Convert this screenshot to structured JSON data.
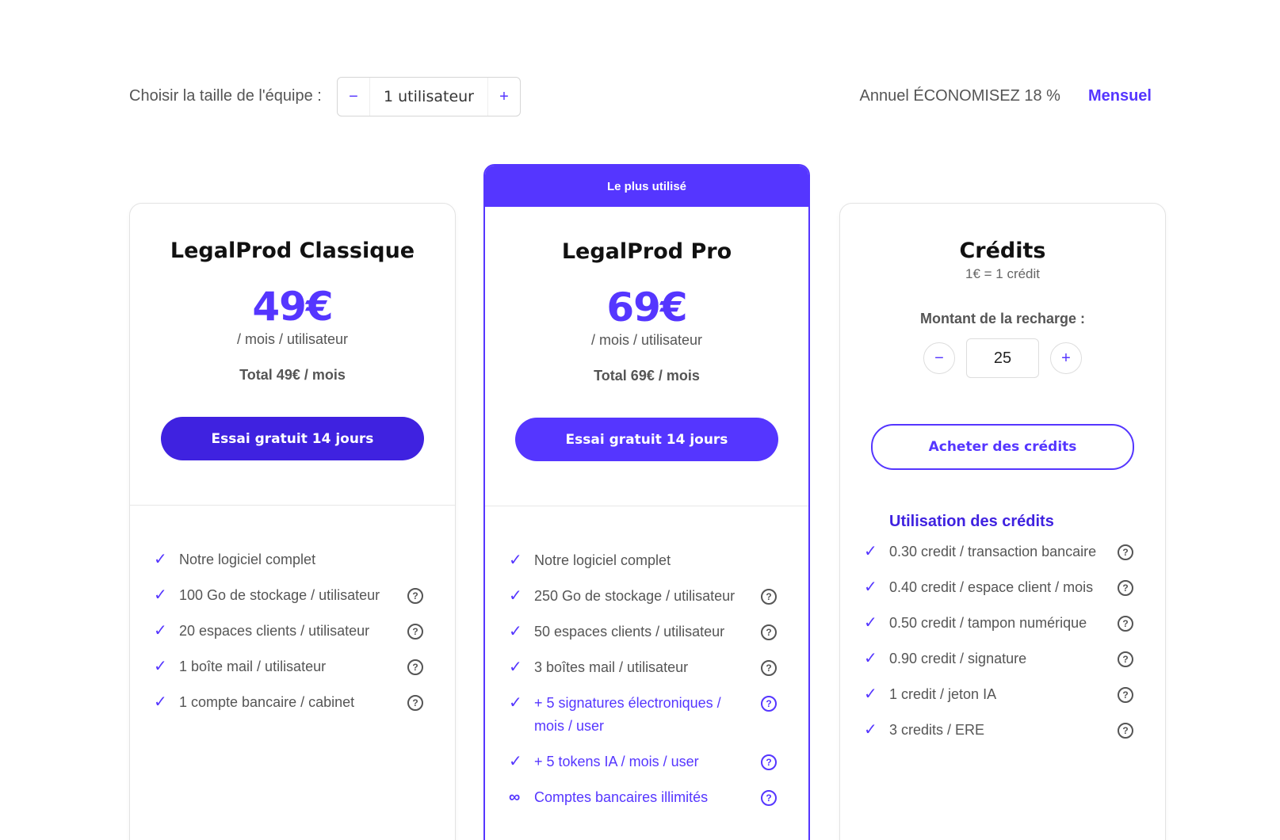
{
  "team": {
    "label": "Choisir la taille de l'équipe :",
    "minus": "−",
    "value": "1 utilisateur",
    "plus": "+"
  },
  "billing": {
    "annual": "Annuel ÉCONOMISEZ 18 %",
    "monthly": "Mensuel"
  },
  "icons": {
    "check": "✓",
    "help": "?",
    "infinity": "∞"
  },
  "colors": {
    "accent": "#5536ff",
    "accent_dark": "#3f22e0"
  },
  "plans": [
    {
      "name": "LegalProd Classique",
      "price": "49€",
      "per": "/ mois / utilisateur",
      "total": "Total 49€ / mois",
      "cta": "Essai gratuit 14 jours",
      "features": [
        "Notre logiciel complet",
        "100 Go de stockage / utilisateur",
        "20 espaces clients / utilisateur",
        "1 boîte mail / utilisateur",
        "1 compte bancaire / cabinet"
      ]
    },
    {
      "badge": "Le plus utilisé",
      "name": "LegalProd Pro",
      "price": "69€",
      "per": "/ mois / utilisateur",
      "total": "Total 69€ / mois",
      "cta": "Essai gratuit 14 jours",
      "features": [
        "Notre logiciel complet",
        "250 Go de stockage / utilisateur",
        "50 espaces clients / utilisateur",
        "3 boîtes mail / utilisateur",
        "+ 5 signatures électroniques / mois / user",
        "+ 5 tokens IA / mois / user",
        "Comptes bancaires illimités"
      ]
    }
  ],
  "credits": {
    "name": "Crédits",
    "rate": "1€ = 1 crédit",
    "recharge_label": "Montant de la recharge :",
    "minus": "−",
    "amount": "25",
    "plus": "+",
    "cta": "Acheter des crédits",
    "usage_title": "Utilisation des crédits",
    "usage": [
      "0.30 credit / transaction bancaire",
      "0.40 credit / espace client / mois",
      "0.50 credit / tampon numérique",
      "0.90 credit / signature",
      "1 credit / jeton IA",
      "3 credits / ERE"
    ]
  }
}
